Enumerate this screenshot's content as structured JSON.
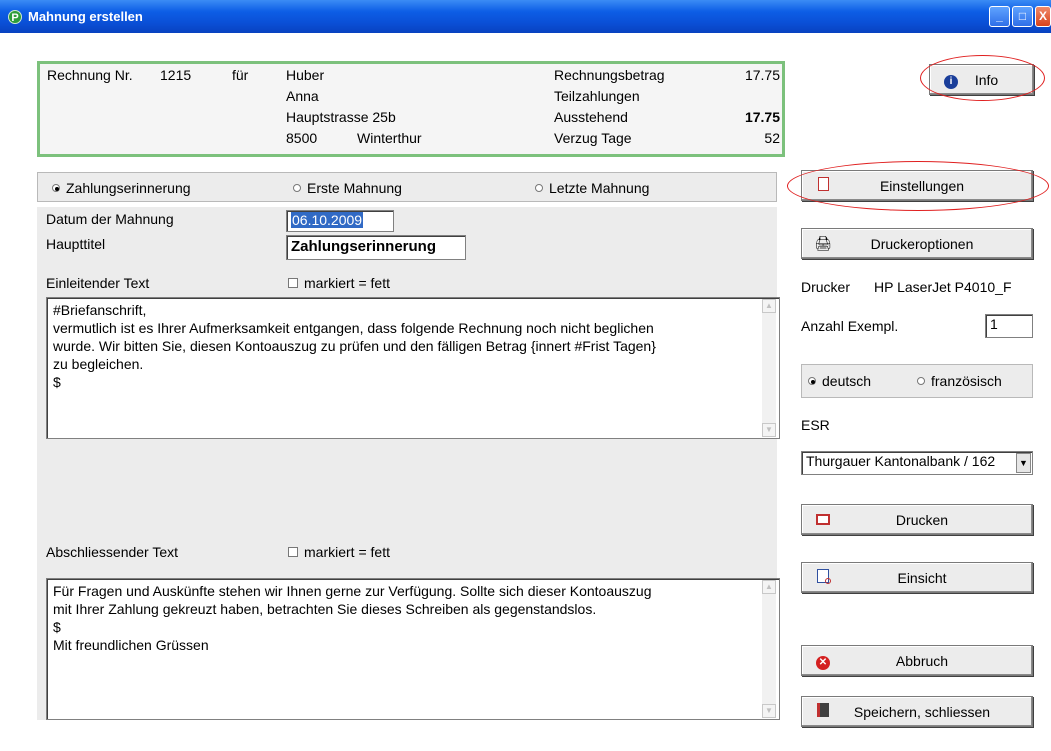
{
  "window": {
    "title": "Mahnung erstellen",
    "icon": "P"
  },
  "invoice": {
    "label_rechnung_nr": "Rechnung Nr.",
    "rechnung_nr": "1215",
    "label_fuer": "für",
    "customer_lastname": "Huber",
    "customer_firstname": "Anna",
    "street": "Hauptstrasse 25b",
    "zip": "8500",
    "city": "Winterthur",
    "label_betrag": "Rechnungsbetrag",
    "betrag": "17.75",
    "label_teilzahlungen": "Teilzahlungen",
    "teilzahlungen": "",
    "label_ausstehend": "Ausstehend",
    "ausstehend": "17.75",
    "label_verzug": "Verzug Tage",
    "verzug": "52"
  },
  "level": {
    "options": [
      "Zahlungserinnerung",
      "Erste Mahnung",
      "Letzte Mahnung"
    ],
    "selected": "Zahlungserinnerung"
  },
  "form": {
    "datum_label": "Datum der Mahnung",
    "datum_value": "06.10.2009",
    "haupttitel_label": "Haupttitel",
    "haupttitel_value": "Zahlungserinnerung",
    "einleitend_label": "Einleitender Text",
    "fett_label": "markiert = fett",
    "einleitend_text": "#Briefanschrift,\nvermutlich ist es Ihrer Aufmerksamkeit entgangen, dass folgende Rechnung noch nicht beglichen\nwurde. Wir bitten Sie, diesen Kontoauszug zu prüfen und den fälligen Betrag {innert #Frist Tagen}\nzu begleichen.\n$",
    "abschliessend_label": "Abschliessender Text",
    "abschliessend_text": "Für Fragen und Auskünfte stehen wir Ihnen gerne zur Verfügung. Sollte sich dieser Kontoauszug\nmit Ihrer Zahlung gekreuzt haben, betrachten Sie dieses Schreiben als gegenstandslos.\n$\nMit freundlichen Grüssen"
  },
  "side": {
    "info_label": "Info",
    "einstellungen_label": "Einstellungen",
    "druckeroptionen_label": "Druckeroptionen",
    "drucker_label": "Drucker",
    "drucker_value": "HP LaserJet P4010_F",
    "anzahl_label": "Anzahl Exempl.",
    "anzahl_value": "1",
    "lang_options": [
      "deutsch",
      "französisch"
    ],
    "lang_selected": "deutsch",
    "esr_label": "ESR",
    "esr_value": "Thurgauer Kantonalbank / 162",
    "drucken_label": "Drucken",
    "einsicht_label": "Einsicht",
    "abbruch_label": "Abbruch",
    "speichern_label": "Speichern, schliessen"
  },
  "colors": {
    "titlebar": "#0a4fd6",
    "frame_green": "#7cc17c",
    "highlight_red": "#e02020",
    "selection_blue": "#316ac5"
  }
}
